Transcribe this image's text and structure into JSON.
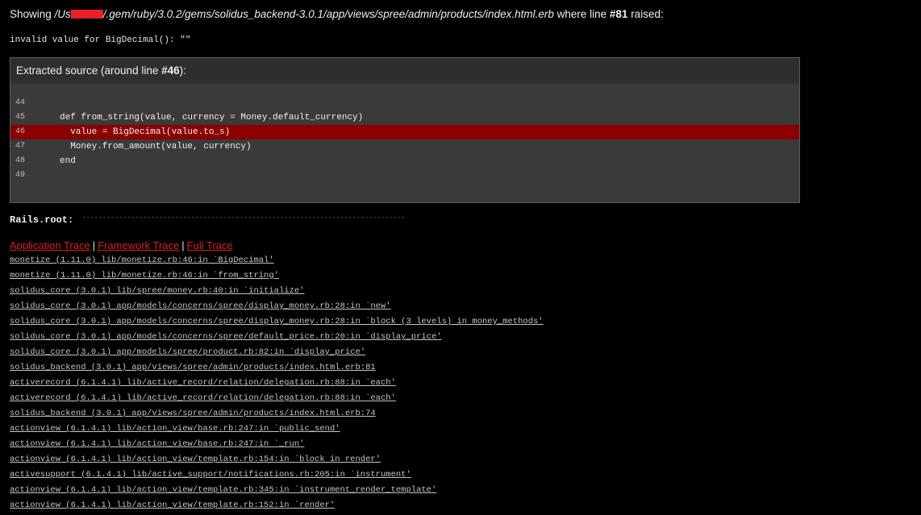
{
  "heading": {
    "prefix": "Showing ",
    "path_start": "/Us",
    "path_rest": "/.gem/ruby/3.0.2/gems/solidus_backend-3.0.1/app/views/spree/admin/products/index.html.erb",
    "middle": " where line ",
    "line": "#81",
    "suffix": " raised:"
  },
  "error_message": "invalid value for BigDecimal(): \"\"",
  "source": {
    "title_prefix": "Extracted source (around line ",
    "title_line": "#46",
    "title_suffix": "):",
    "lines": [
      {
        "no": "44",
        "code": ""
      },
      {
        "no": "45",
        "code": "def from_string(value, currency = Money.default_currency)"
      },
      {
        "no": "46",
        "code": "  value = BigDecimal(value.to_s)"
      },
      {
        "no": "47",
        "code": "  Money.from_amount(value, currency)"
      },
      {
        "no": "48",
        "code": "end"
      },
      {
        "no": "49",
        "code": ""
      }
    ],
    "highlight_no": "46"
  },
  "rails_root_label": "Rails.root:",
  "trace_tabs": {
    "application": "Application Trace",
    "framework": "Framework Trace",
    "full": "Full Trace",
    "separator": "|"
  },
  "trace": [
    "monetize (1.11.0) lib/monetize.rb:46:in `BigDecimal'",
    "monetize (1.11.0) lib/monetize.rb:46:in `from_string'",
    "solidus_core (3.0.1) lib/spree/money.rb:40:in `initialize'",
    "solidus_core (3.0.1) app/models/concerns/spree/display_money.rb:28:in `new'",
    "solidus_core (3.0.1) app/models/concerns/spree/display_money.rb:28:in `block (3 levels) in money_methods'",
    "solidus_core (3.0.1) app/models/concerns/spree/default_price.rb:20:in `display_price'",
    "solidus_core (3.0.1) app/models/spree/product.rb:82:in `display_price'",
    "solidus_backend (3.0.1) app/views/spree/admin/products/index.html.erb:81",
    "activerecord (6.1.4.1) lib/active_record/relation/delegation.rb:88:in `each'",
    "activerecord (6.1.4.1) lib/active_record/relation/delegation.rb:88:in `each'",
    "solidus_backend (3.0.1) app/views/spree/admin/products/index.html.erb:74",
    "actionview (6.1.4.1) lib/action_view/base.rb:247:in `public_send'",
    "actionview (6.1.4.1) lib/action_view/base.rb:247:in `_run'",
    "actionview (6.1.4.1) lib/action_view/template.rb:154:in `block in render'",
    "activesupport (6.1.4.1) lib/active_support/notifications.rb:205:in `instrument'",
    "actionview (6.1.4.1) lib/action_view/template.rb:345:in `instrument_render_template'",
    "actionview (6.1.4.1) lib/action_view/template.rb:152:in `render'"
  ],
  "colors": {
    "background": "#000000",
    "link_red": "#d9201a",
    "highlight": "#8b0000",
    "code_bg": "#3a3a3a",
    "redaction_red": "#e8202a"
  }
}
